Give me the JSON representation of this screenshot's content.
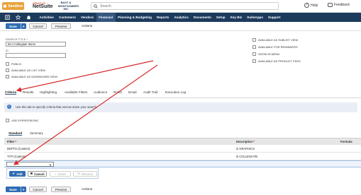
{
  "header": {
    "sandbox_label": "Sandbox",
    "logo_oracle": "ORACLE",
    "logo_netsuite": "NetSuite",
    "partner_logo": "BAST & MONTGOMERY INC",
    "search_placeholder": "Search",
    "help_label": "Help",
    "feedback_label": "Feedback"
  },
  "nav": {
    "items": [
      {
        "label": "Activities"
      },
      {
        "label": "Customers"
      },
      {
        "label": "Vendors"
      },
      {
        "label": "Financial"
      },
      {
        "label": "Planning & Budgeting"
      },
      {
        "label": "Reports"
      },
      {
        "label": "Analytics"
      },
      {
        "label": "Documents"
      },
      {
        "label": "Setup"
      },
      {
        "label": "Key Biz"
      },
      {
        "label": "SuiteApps"
      },
      {
        "label": "Support"
      }
    ],
    "active": "Financial"
  },
  "toolbar": {
    "save": "Save",
    "cancel": "Cancel",
    "preview": "Preview",
    "actions": "Actions"
  },
  "form": {
    "search_title_label": "SEARCH TITLE",
    "search_title_value": "BAJ Collegiate Items",
    "id_label": "ID",
    "id_value": "",
    "public_label": "PUBLIC",
    "available_as_list_view": "AVAILABLE AS LIST VIEW",
    "available_as_dashboard_view": "AVAILABLE AS DASHBOARD VIEW",
    "right_checkboxes": [
      {
        "label": "AVAILABLE AS SUBLIST VIEW"
      },
      {
        "label": "AVAILABLE FOR REMINDERS"
      },
      {
        "label": "SHOW IN MENU"
      },
      {
        "label": "AVAILABLE AS PRODUCT FEED"
      }
    ]
  },
  "tabs": [
    {
      "label": "Criteria"
    },
    {
      "label": "Results"
    },
    {
      "label": "Highlighting"
    },
    {
      "label": "Available Filters"
    },
    {
      "label": "Audience"
    },
    {
      "label": "Roles"
    },
    {
      "label": "Email"
    },
    {
      "label": "Audit Trail"
    },
    {
      "label": "Execution Log"
    }
  ],
  "info_text": "Use this tab to specify criteria that narrow down your search.",
  "use_expressions_label": "USE EXPRESSIONS",
  "subtabs": {
    "standard": "Standard",
    "summary": "Summary"
  },
  "grid": {
    "headers": {
      "filter": "Filter",
      "description": "Description",
      "formula": "Formula"
    },
    "rows": [
      {
        "filter": "DEPTS (Custom)",
        "description": "is GRAPHICS"
      },
      {
        "filter": "TYP (Custom)",
        "description": "is COLLEGIATE"
      }
    ]
  },
  "actions": {
    "add": "Add",
    "cancel": "Cancel",
    "insert": "Insert",
    "remove": "Remove"
  },
  "colors": {
    "nav_bg": "#1c3a5c",
    "primary_button": "#2f6db3",
    "annotation_arrow": "#d62a2a"
  }
}
